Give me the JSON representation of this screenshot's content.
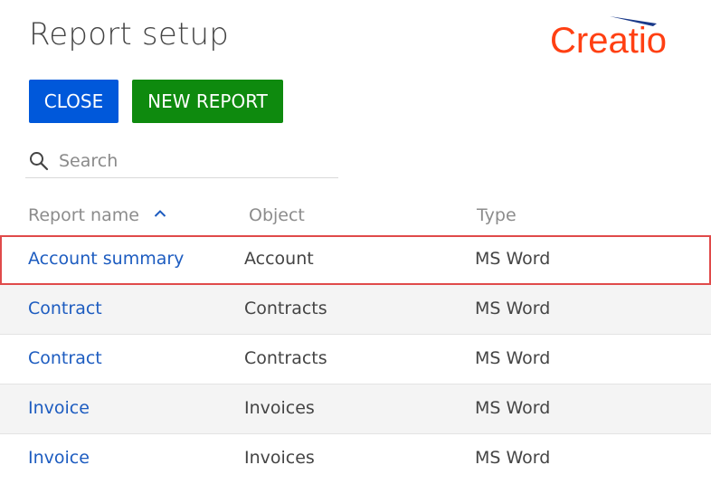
{
  "header": {
    "title": "Report setup",
    "logo_text": "Creatio",
    "logo_color": "#ff4013",
    "logo_accent_color": "#1a3a8a"
  },
  "toolbar": {
    "close_label": "CLOSE",
    "new_report_label": "NEW REPORT",
    "close_color": "#0058da",
    "new_report_color": "#0e8a0e"
  },
  "search": {
    "placeholder": "Search",
    "value": ""
  },
  "table": {
    "columns": {
      "name": "Report name",
      "object": "Object",
      "type": "Type"
    },
    "sort": {
      "column": "Report name",
      "direction": "ascending"
    },
    "rows": [
      {
        "name": "Account summary",
        "object": "Account",
        "type": "MS Word",
        "selected": true
      },
      {
        "name": "Contract",
        "object": "Contracts",
        "type": "MS Word",
        "selected": false
      },
      {
        "name": "Contract",
        "object": "Contracts",
        "type": "MS Word",
        "selected": false
      },
      {
        "name": "Invoice",
        "object": "Invoices",
        "type": "MS Word",
        "selected": false
      },
      {
        "name": "Invoice",
        "object": "Invoices",
        "type": "MS Word",
        "selected": false
      }
    ]
  },
  "colors": {
    "link": "#1d5cc0",
    "selection_border": "#e04a4a"
  }
}
